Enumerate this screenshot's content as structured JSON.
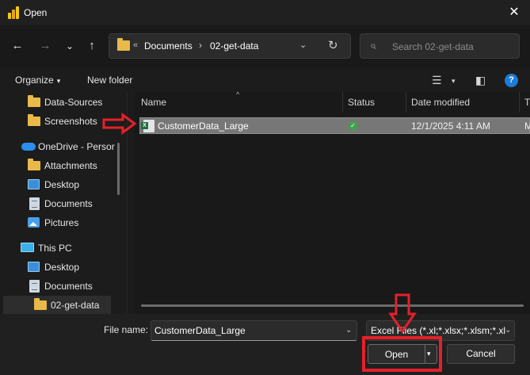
{
  "window": {
    "title": "Open",
    "close_glyph": "✕"
  },
  "nav": {
    "back_glyph": "←",
    "forward_glyph": "→",
    "recent_glyph": "⌄",
    "up_glyph": "↑",
    "address": {
      "prefix": "«",
      "crumbs": [
        "Documents",
        "02-get-data"
      ],
      "separator": "›",
      "dropdown_glyph": "⌄",
      "refresh_glyph": "↻"
    },
    "search": {
      "placeholder": "Search 02-get-data",
      "icon": "search-icon"
    }
  },
  "commands": {
    "organize": "Organize",
    "organize_caret": "▾",
    "new_folder": "New folder",
    "view_glyph": "☰",
    "view_caret": "▾",
    "preview_glyph": "◧",
    "help_glyph": "?"
  },
  "sidebar": {
    "items": [
      {
        "label": "Data-Sources",
        "icon": "folder-icon"
      },
      {
        "label": "Screenshots",
        "icon": "folder-icon"
      },
      {
        "label": "OneDrive - Persor",
        "icon": "cloud-icon"
      },
      {
        "label": "Attachments",
        "icon": "folder-icon"
      },
      {
        "label": "Desktop",
        "icon": "desktop-icon"
      },
      {
        "label": "Documents",
        "icon": "documents-icon"
      },
      {
        "label": "Pictures",
        "icon": "pictures-icon"
      },
      {
        "label": "This PC",
        "icon": "pc-icon"
      },
      {
        "label": "Desktop",
        "icon": "desktop-icon"
      },
      {
        "label": "Documents",
        "icon": "documents-icon"
      },
      {
        "label": "02-get-data",
        "icon": "folder-icon",
        "selected": true
      }
    ]
  },
  "list": {
    "sort_glyph": "^",
    "columns": [
      "Name",
      "Status",
      "Date modified",
      "T"
    ],
    "rows": [
      {
        "name": "CustomerData_Large",
        "status_glyph": "✓",
        "date_modified": "12/1/2025 4:11 AM",
        "type": "M",
        "selected": true
      }
    ]
  },
  "footer": {
    "file_name_label": "File name:",
    "file_name_value": "CustomerData_Large",
    "file_name_caret": "⌄",
    "file_type": "Excel Files (*.xl;*.xlsx;*.xlsm;*.xl",
    "file_type_caret": "⌄",
    "open_label": "Open",
    "open_caret": "▾",
    "cancel_label": "Cancel"
  },
  "colors": {
    "annotation": "#e5202a",
    "folder": "#e9b949",
    "accent": "#1d7cd6",
    "excel": "#1d6f42",
    "selection": "#777777"
  }
}
